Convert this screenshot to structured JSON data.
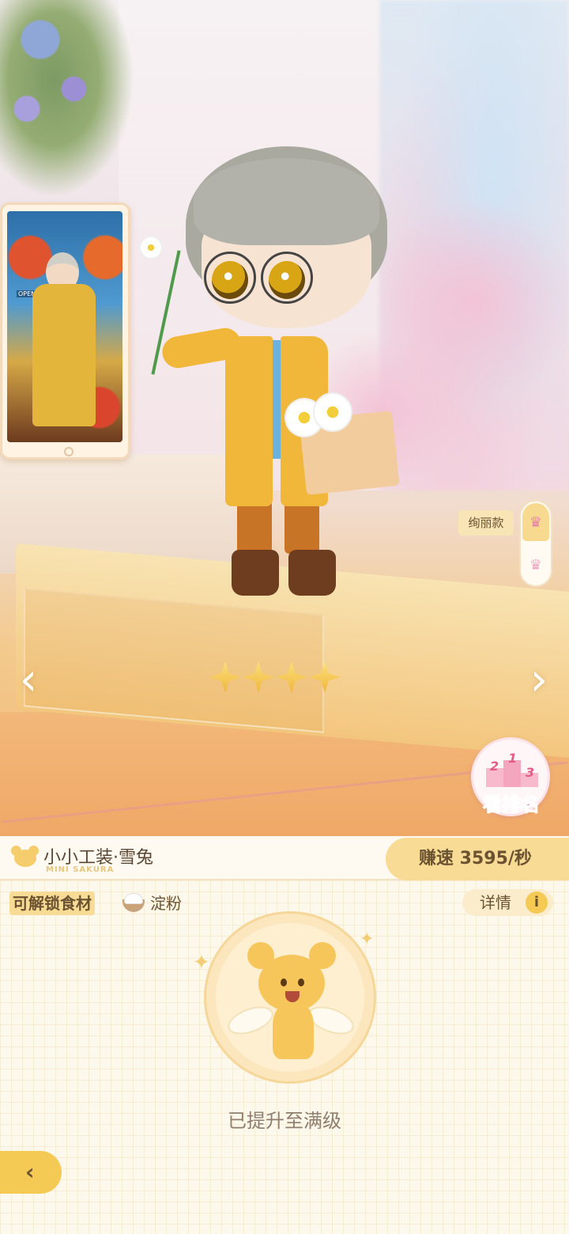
{
  "scene": {
    "photo_card": {
      "sign_text": "OPEN"
    },
    "side_tabs": {
      "active_label": "绚丽款",
      "tabs": [
        {
          "icon": "crown-icon",
          "active": true
        },
        {
          "icon": "crown-icon",
          "active": false
        }
      ]
    },
    "rarity_stars": 4,
    "nav": {
      "prev_icon": "chevron-left-icon",
      "next_icon": "chevron-right-icon",
      "prev_glyph": "‹",
      "next_glyph": "›"
    },
    "ranking": {
      "label": "看排名",
      "podium": [
        "1",
        "2",
        "3"
      ]
    }
  },
  "panel": {
    "outfit_name": "小小工装·雪兔",
    "outfit_series": "MINI SAKURA",
    "earn_speed": "赚速 3595/秒",
    "unlock_label": "可解锁食材",
    "ingredient": {
      "name": "淀粉",
      "icon": "rice-bowl-icon"
    },
    "detail_label": "详情",
    "detail_icon_glyph": "i",
    "status_text": "已提升至满级",
    "back_glyph": "‹"
  },
  "colors": {
    "accent_yellow": "#f8db95",
    "text_brown": "#6b5331",
    "rank_pink": "#e45b86",
    "panel_bg": "#fdf8ec"
  }
}
